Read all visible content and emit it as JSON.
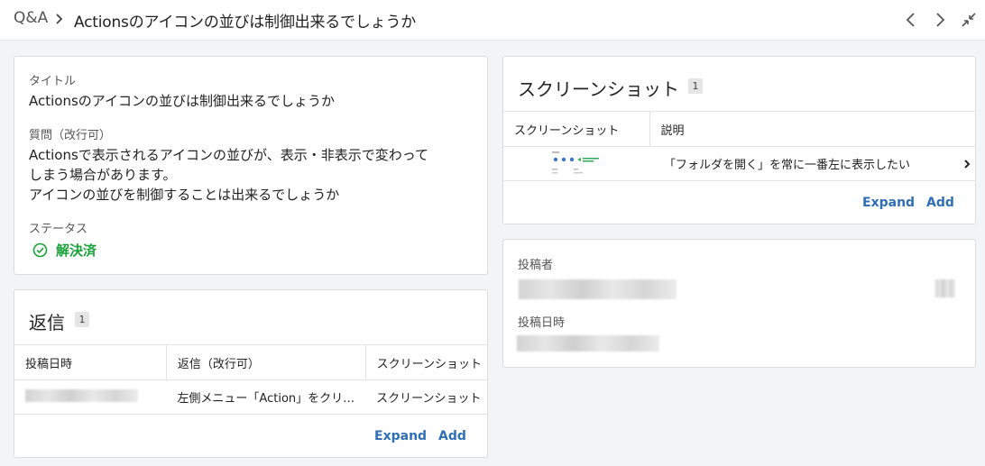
{
  "breadcrumb": {
    "root": "Q&A",
    "title": "Actionsのアイコンの並びは制御出来るでしょうか"
  },
  "detail": {
    "title_label": "タイトル",
    "title_value": "Actionsのアイコンの並びは制御出来るでしょうか",
    "question_label": "質問（改行可）",
    "question_lines": [
      "Actionsで表示されるアイコンの並びが、表示・非表示で変わって",
      "しまう場合があります。",
      "アイコンの並びを制御することは出来るでしょうか"
    ],
    "status_label": "ステータス",
    "status_value": "解決済",
    "status_color": "#1aa33a"
  },
  "replies": {
    "title": "返信",
    "count": "1",
    "columns": [
      "投稿日時",
      "返信（改行可）",
      "スクリーンショット"
    ],
    "rows": [
      {
        "reply": "左側メニュー「Action」をクリ…",
        "screenshot": "スクリーンショット"
      }
    ],
    "expand_label": "Expand",
    "add_label": "Add"
  },
  "screenshots": {
    "title": "スクリーンショット",
    "count": "1",
    "columns": [
      "スクリーンショット",
      "説明"
    ],
    "rows": [
      {
        "description": "「フォルダを開く」を常に一番左に表示したい"
      }
    ],
    "expand_label": "Expand",
    "add_label": "Add"
  },
  "poster": {
    "poster_label": "投稿者",
    "posted_at_label": "投稿日時"
  },
  "icons": [
    "chevron-right-icon",
    "chevron-left-icon",
    "chevron-right-icon",
    "collapse-icon",
    "check-circle-icon"
  ],
  "accent_color": "#2f6fb4"
}
